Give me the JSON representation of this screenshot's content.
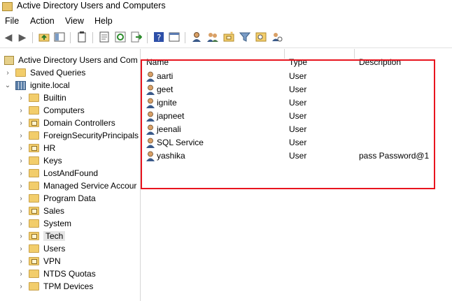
{
  "window": {
    "title": "Active Directory Users and Computers"
  },
  "menu": [
    "File",
    "Action",
    "View",
    "Help"
  ],
  "toolbar_icons": [
    "back-arrow-icon",
    "forward-arrow-icon",
    "up-folder-icon",
    "show-hide-console-tree-icon",
    "delete-icon",
    "properties-icon",
    "refresh-icon",
    "export-list-icon",
    "help-icon",
    "mmc-icon",
    "new-user-icon",
    "new-group-icon",
    "new-ou-icon",
    "filter-icon",
    "find-icon",
    "add-to-group-icon"
  ],
  "tree": {
    "root": "Active Directory Users and Com",
    "saved_queries": "Saved Queries",
    "domain": "ignite.local",
    "children": [
      {
        "label": "Builtin",
        "ou": false
      },
      {
        "label": "Computers",
        "ou": false
      },
      {
        "label": "Domain Controllers",
        "ou": true
      },
      {
        "label": "ForeignSecurityPrincipals",
        "ou": false
      },
      {
        "label": "HR",
        "ou": true
      },
      {
        "label": "Keys",
        "ou": false
      },
      {
        "label": "LostAndFound",
        "ou": false
      },
      {
        "label": "Managed Service Accour",
        "ou": false
      },
      {
        "label": "Program Data",
        "ou": false
      },
      {
        "label": "Sales",
        "ou": true
      },
      {
        "label": "System",
        "ou": false
      },
      {
        "label": "Tech",
        "ou": true,
        "selected": true
      },
      {
        "label": "Users",
        "ou": false
      },
      {
        "label": "VPN",
        "ou": true
      },
      {
        "label": "NTDS Quotas",
        "ou": false
      },
      {
        "label": "TPM Devices",
        "ou": false
      }
    ]
  },
  "list": {
    "columns": [
      "Name",
      "Type",
      "Description"
    ],
    "rows": [
      {
        "name": "aarti",
        "type": "User",
        "description": ""
      },
      {
        "name": "geet",
        "type": "User",
        "description": ""
      },
      {
        "name": "ignite",
        "type": "User",
        "description": ""
      },
      {
        "name": "japneet",
        "type": "User",
        "description": ""
      },
      {
        "name": "jeenali",
        "type": "User",
        "description": ""
      },
      {
        "name": "SQL Service",
        "type": "User",
        "description": ""
      },
      {
        "name": "yashika",
        "type": "User",
        "description": "pass Password@1"
      }
    ]
  },
  "colors": {
    "highlight": "#e8141e",
    "folder": "#f2cd6b"
  }
}
